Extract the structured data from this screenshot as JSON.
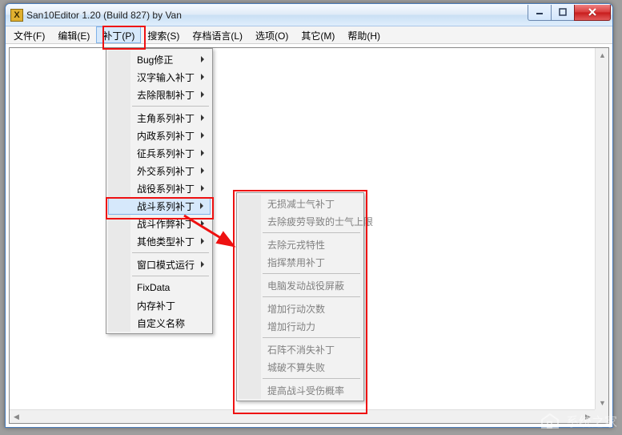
{
  "window": {
    "title": "San10Editor 1.20 (Build 827) by Van",
    "controls": {
      "min": "–",
      "max": "☐",
      "close": "✕"
    }
  },
  "menubar": {
    "items": [
      {
        "label": "文件(F)"
      },
      {
        "label": "编辑(E)"
      },
      {
        "label": "补丁(P)",
        "active": true
      },
      {
        "label": "搜索(S)"
      },
      {
        "label": "存档语言(L)"
      },
      {
        "label": "选项(O)"
      },
      {
        "label": "其它(M)"
      },
      {
        "label": "帮助(H)"
      }
    ]
  },
  "dropdown": {
    "items": [
      {
        "label": "Bug修正",
        "submenu": true
      },
      {
        "label": "汉字输入补丁",
        "submenu": true
      },
      {
        "label": "去除限制补丁",
        "submenu": true
      },
      {
        "sep": true
      },
      {
        "label": "主角系列补丁",
        "submenu": true
      },
      {
        "label": "内政系列补丁",
        "submenu": true
      },
      {
        "label": "征兵系列补丁",
        "submenu": true
      },
      {
        "label": "外交系列补丁",
        "submenu": true
      },
      {
        "label": "战役系列补丁",
        "submenu": true
      },
      {
        "label": "战斗系列补丁",
        "submenu": true,
        "hover": true
      },
      {
        "label": "战斗作弊补丁",
        "submenu": true
      },
      {
        "label": "其他类型补丁",
        "submenu": true
      },
      {
        "sep": true
      },
      {
        "label": "窗口模式运行",
        "submenu": true
      },
      {
        "sep": true
      },
      {
        "label": "FixData"
      },
      {
        "label": "内存补丁"
      },
      {
        "label": "自定义名称"
      }
    ]
  },
  "submenu": {
    "items": [
      {
        "label": "无损减士气补丁"
      },
      {
        "label": "去除疲劳导致的士气上限"
      },
      {
        "sep": true
      },
      {
        "label": "去除元戎特性"
      },
      {
        "label": "指挥禁用补丁"
      },
      {
        "sep": true
      },
      {
        "label": "电脑发动战役屏蔽"
      },
      {
        "sep": true
      },
      {
        "label": "增加行动次数"
      },
      {
        "label": "增加行动力"
      },
      {
        "sep": true
      },
      {
        "label": "石阵不消失补丁"
      },
      {
        "label": "城破不算失败"
      },
      {
        "sep": true
      },
      {
        "label": "提高战斗受伤概率"
      }
    ]
  },
  "watermark": "系统之家"
}
